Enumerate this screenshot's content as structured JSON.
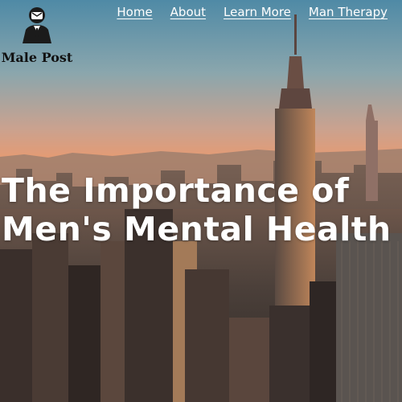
{
  "brand": {
    "name": "Male Post",
    "icon": "businessman-icon"
  },
  "nav": {
    "items": [
      {
        "label": "Home"
      },
      {
        "label": "About"
      },
      {
        "label": "Learn More"
      },
      {
        "label": "Man Therapy"
      }
    ]
  },
  "hero": {
    "title_line1": "The Importance of",
    "title_line2": "Men's Mental Health",
    "background": "city-skyline-sunset"
  },
  "colors": {
    "nav_text": "#ffffff",
    "headline": "#ffffff",
    "logo_text": "#111111"
  }
}
